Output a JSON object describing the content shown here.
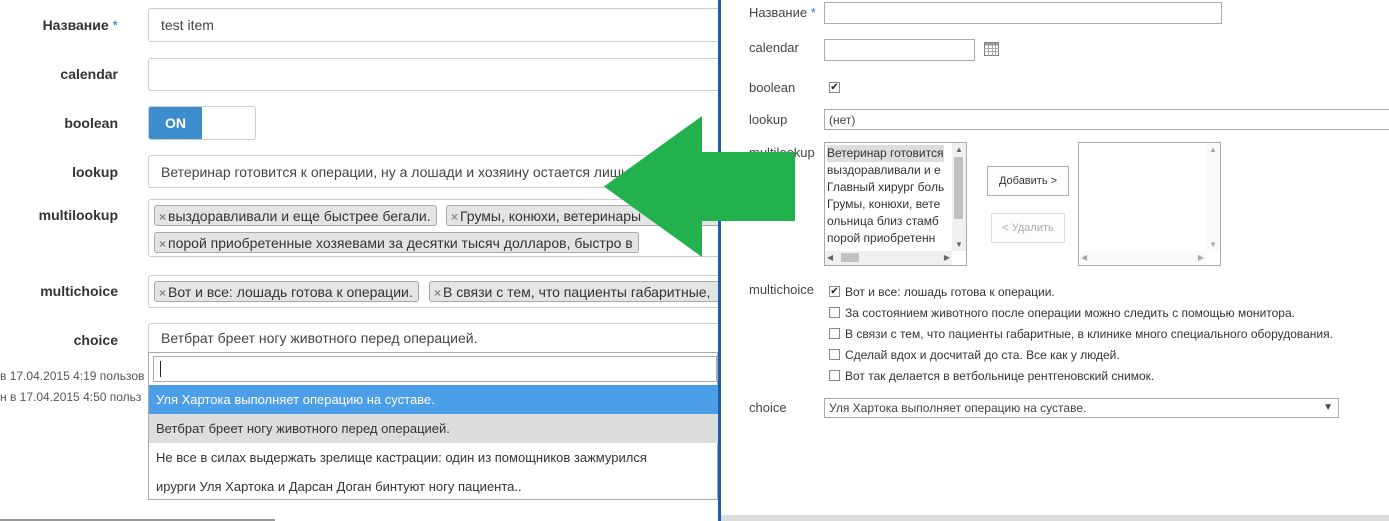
{
  "left": {
    "fields": {
      "name_label": "Название",
      "required_mark": "*",
      "name_value": "test item",
      "calendar_label": "calendar",
      "boolean_label": "boolean",
      "toggle_on": "ON",
      "lookup_label": "lookup",
      "lookup_value": "Ветеринар готовится к операции, ну а лошади и хозяину остается лишь",
      "multilookup_label": "multilookup",
      "multilookup_tags": [
        "выздоравливали и еще быстрее бегали.",
        "Грумы, конюхи, ветеринары",
        "порой приобретенные хозяевами за десятки тысяч долларов, быстро в"
      ],
      "multichoice_label": "multichoice",
      "multichoice_tags": [
        "Вот и все: лошадь готова к операции.",
        "В связи с тем, что пациенты габаритные,"
      ],
      "choice_label": "choice",
      "choice_value": "Ветбрат бреет ногу животного перед операцией."
    },
    "tag_remove": "×",
    "dropdown_options": [
      "Уля Хартока выполняет операцию на суставе.",
      "Ветбрат бреет ногу животного перед операцией.",
      "Не все в силах выдержать зрелище кастрации: один из помощников зажмурился",
      "ирурги Уля Хартока и Дарсан Доган бинтуют ногу пациента.."
    ],
    "meta": [
      "в 17.04.2015 4:19   пользов",
      "н в 17.04.2015 4:50   польз"
    ]
  },
  "right": {
    "name_label": "Название",
    "required_mark": "*",
    "calendar_label": "calendar",
    "boolean_label": "boolean",
    "boolean_checked": "✔",
    "lookup_label": "lookup",
    "lookup_value": "(нет)",
    "multilookup_label": "multilookup",
    "multilookup_items": [
      "Ветеринар готовится",
      "выздоравливали и е",
      "Главный хирург боль",
      "Грумы, конюхи, вете",
      "ольница близ стамб",
      "порой приобретенн"
    ],
    "add_button": "Добавить >",
    "remove_button": "< Удалить",
    "multichoice_label": "multichoice",
    "multichoice_options": [
      {
        "label": "Вот и все: лошадь готова к операции.",
        "mark": "✔"
      },
      {
        "label": "За состоянием животного после операции можно следить с помощью монитора.",
        "mark": ""
      },
      {
        "label": "В связи с тем, что пациенты габаритные, в клинике много специального оборудования.",
        "mark": ""
      },
      {
        "label": "Сделай вдох и досчитай до ста. Все как у людей.",
        "mark": ""
      },
      {
        "label": "Вот так делается в ветбольнице рентгеновский снимок.",
        "mark": ""
      }
    ],
    "choice_label": "choice",
    "choice_value": "Уля Хартока выполняет операцию на суставе.",
    "dropdown_arrow": "▼"
  },
  "colors": {
    "arrow": "#22b14c",
    "toggle_on": "#3c8dcd",
    "highlight": "#4d9ee8",
    "divider": "#1b5fa8"
  }
}
